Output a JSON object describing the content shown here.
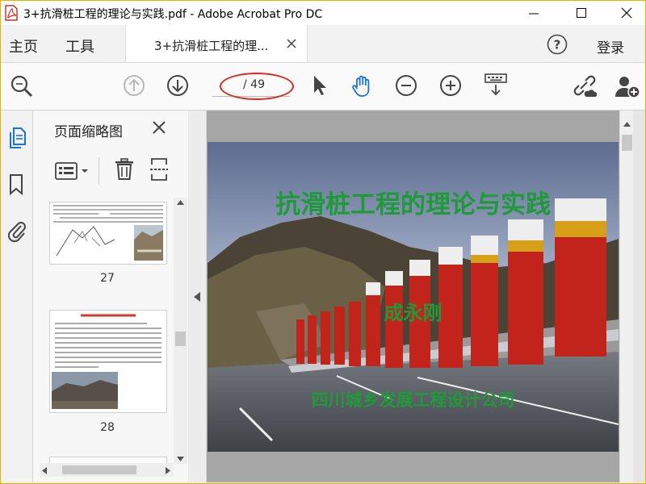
{
  "window": {
    "title": "3+抗滑桩工程的理论与实践.pdf - Adobe Acrobat Pro DC"
  },
  "tabs": {
    "home": "主页",
    "tools": "工具",
    "document_tab": "3+抗滑桩工程的理...",
    "login": "登录"
  },
  "toolbar": {
    "page_current": "",
    "page_total": "/ 49",
    "highlight_color": "#e1261c",
    "active_tool_color": "#1a73d9"
  },
  "sidebar": {
    "panel_title": "页面缩略图",
    "thumbnails": [
      {
        "page_label": "27"
      },
      {
        "page_label": "28"
      }
    ]
  },
  "slide": {
    "title": "抗滑桩工程的理论与实践",
    "author": "成永刚",
    "organization": "四川城乡发展工程设计公司",
    "text_color": "#1f9a3a"
  },
  "icons": {
    "pdf": "pdf-file-icon",
    "minimize": "minimize-icon",
    "maximize": "maximize-icon",
    "close": "close-icon",
    "help": "help-icon",
    "zoom": "zoom-search-icon",
    "prev": "page-up-icon",
    "next": "page-down-icon",
    "select": "pointer-icon",
    "hand": "hand-icon",
    "zoom_out": "zoom-out-icon",
    "zoom_in": "zoom-in-icon",
    "keyboard": "keyboard-scroll-icon",
    "link": "share-link-icon",
    "add_user": "add-user-icon"
  }
}
